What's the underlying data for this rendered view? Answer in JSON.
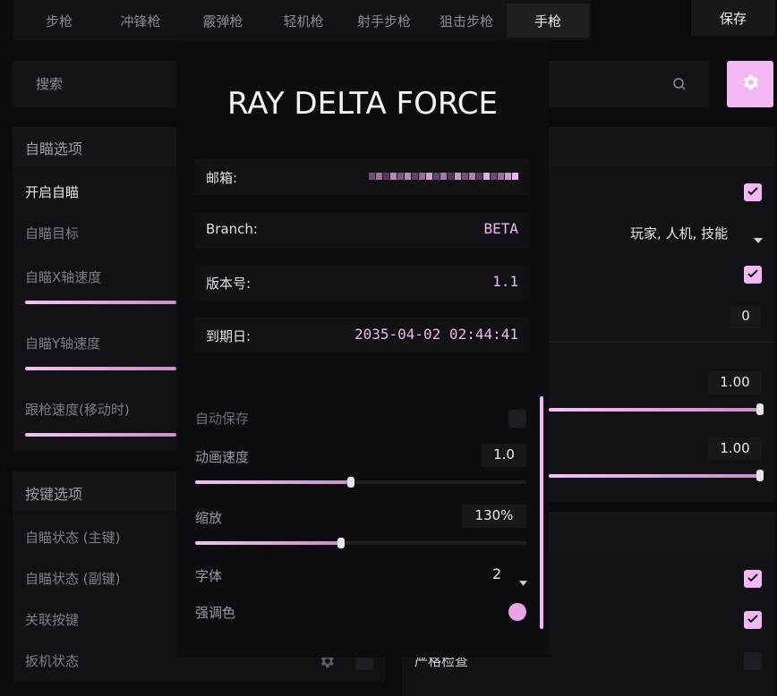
{
  "tabs": [
    "步枪",
    "冲锋枪",
    "霰弹枪",
    "轻机枪",
    "射手步枪",
    "狙击步枪",
    "手枪"
  ],
  "active_tab": "手枪",
  "save_label": "保存",
  "search_placeholder": "搜索",
  "aim_section": {
    "title": "自瞄选项",
    "items": [
      "开启自瞄",
      "自瞄目标",
      "自瞄X轴速度",
      "自瞄Y轴速度",
      "跟枪速度(移动时)"
    ]
  },
  "key_section": {
    "title": "按键选项",
    "items": [
      "自瞄状态 (主键)",
      "自瞄状态 (副键)",
      "关联按键",
      "扳机状态"
    ]
  },
  "right_column": {
    "target_value": "玩家, 人机, 技能",
    "number_value": "0",
    "x_speed_value": "1.00",
    "y_speed_value": "1.00",
    "strict_check_label": "严格检查"
  },
  "overlay": {
    "title": "RAY DELTA FORCE",
    "email_label": "邮箱:",
    "branch_label": "Branch:",
    "branch_value": "BETA",
    "version_label": "版本号:",
    "version_value": "1.1",
    "expiry_label": "到期日:",
    "expiry_value": "2035-04-02 02:44:41",
    "autosave_label": "自动保存",
    "anim_speed_label": "动画速度",
    "anim_speed_value": "1.0",
    "zoom_label": "缩放",
    "zoom_value": "130%",
    "font_label": "字体",
    "font_value": "2",
    "accent_label": "强调色",
    "accent_color": "#e8a6e8",
    "anim_speed_fill": 0.47,
    "zoom_fill": 0.44
  },
  "colors": {
    "accent": "#f3b8f3",
    "background": "#0b0b0f"
  }
}
